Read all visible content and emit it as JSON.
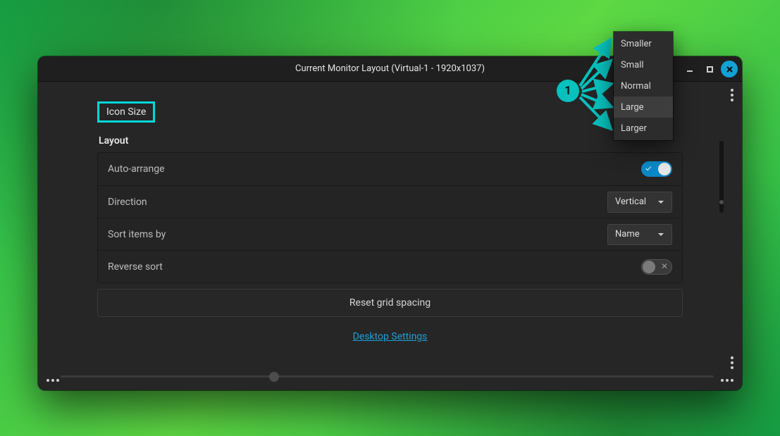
{
  "window": {
    "title": "Current Monitor Layout (Virtual-1 - 1920x1037)"
  },
  "highlight_label": "Icon Size",
  "section_title": "Layout",
  "rows": {
    "auto_arrange": {
      "label": "Auto-arrange",
      "value": true
    },
    "direction": {
      "label": "Direction",
      "value": "Vertical"
    },
    "sort_by": {
      "label": "Sort items by",
      "value": "Name"
    },
    "reverse": {
      "label": "Reverse sort",
      "value": false
    }
  },
  "reset_label": "Reset grid spacing",
  "link_label": "Desktop Settings",
  "menu": {
    "items": [
      "Smaller",
      "Small",
      "Normal",
      "Large",
      "Larger"
    ],
    "hovered_index": 3
  },
  "annotation": {
    "badge": "1"
  }
}
